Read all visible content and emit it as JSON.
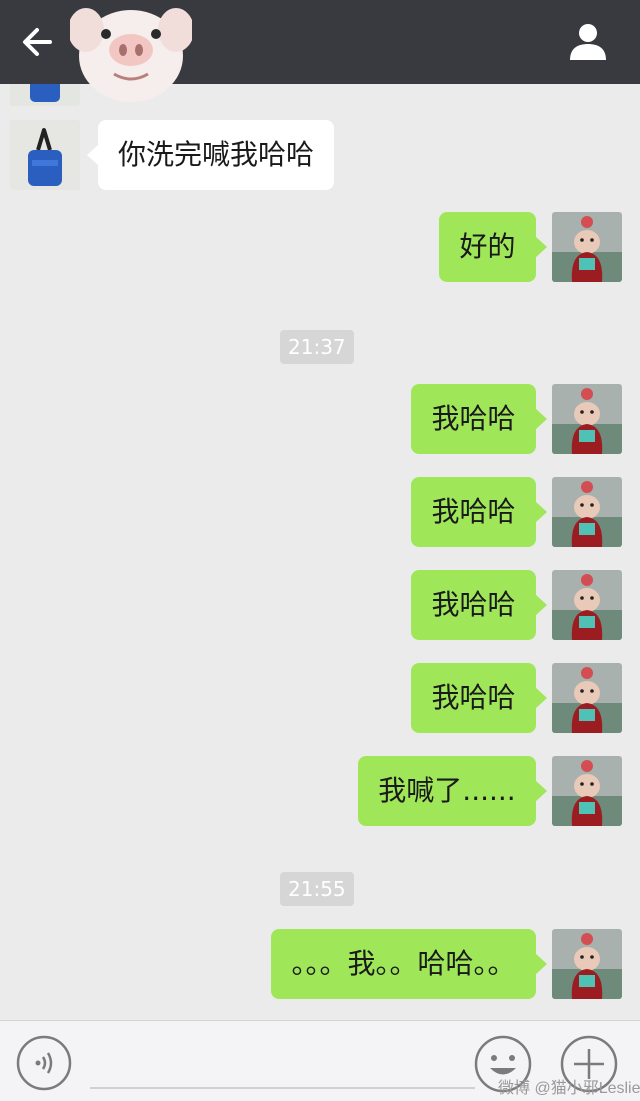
{
  "header": {
    "back_icon": "arrow-left-icon",
    "profile_icon": "person-icon",
    "sticker": "pig-face-sticker"
  },
  "chat": {
    "received": [
      {
        "text": "你洗完喊我哈哈"
      }
    ],
    "sent_first": [
      {
        "text": "好的"
      }
    ],
    "time_1": "21:37",
    "sent_second": [
      {
        "text": "我哈哈"
      },
      {
        "text": "我哈哈"
      },
      {
        "text": "我哈哈"
      },
      {
        "text": "我哈哈"
      },
      {
        "text": "我喊了......"
      }
    ],
    "time_2": "21:55",
    "sent_third": [
      {
        "text": "。。。我。。哈哈。。"
      }
    ]
  },
  "footer": {
    "voice_icon": "voice-icon",
    "emoji_icon": "smiley-icon",
    "plus_icon": "plus-icon",
    "watermark": "微博 @猫小邪Leslie"
  },
  "colors": {
    "topbar": "#393a3f",
    "background": "#ebebeb",
    "sent_bubble": "#9fe759",
    "received_bubble": "#ffffff",
    "time_badge": "#d6d6d6"
  }
}
